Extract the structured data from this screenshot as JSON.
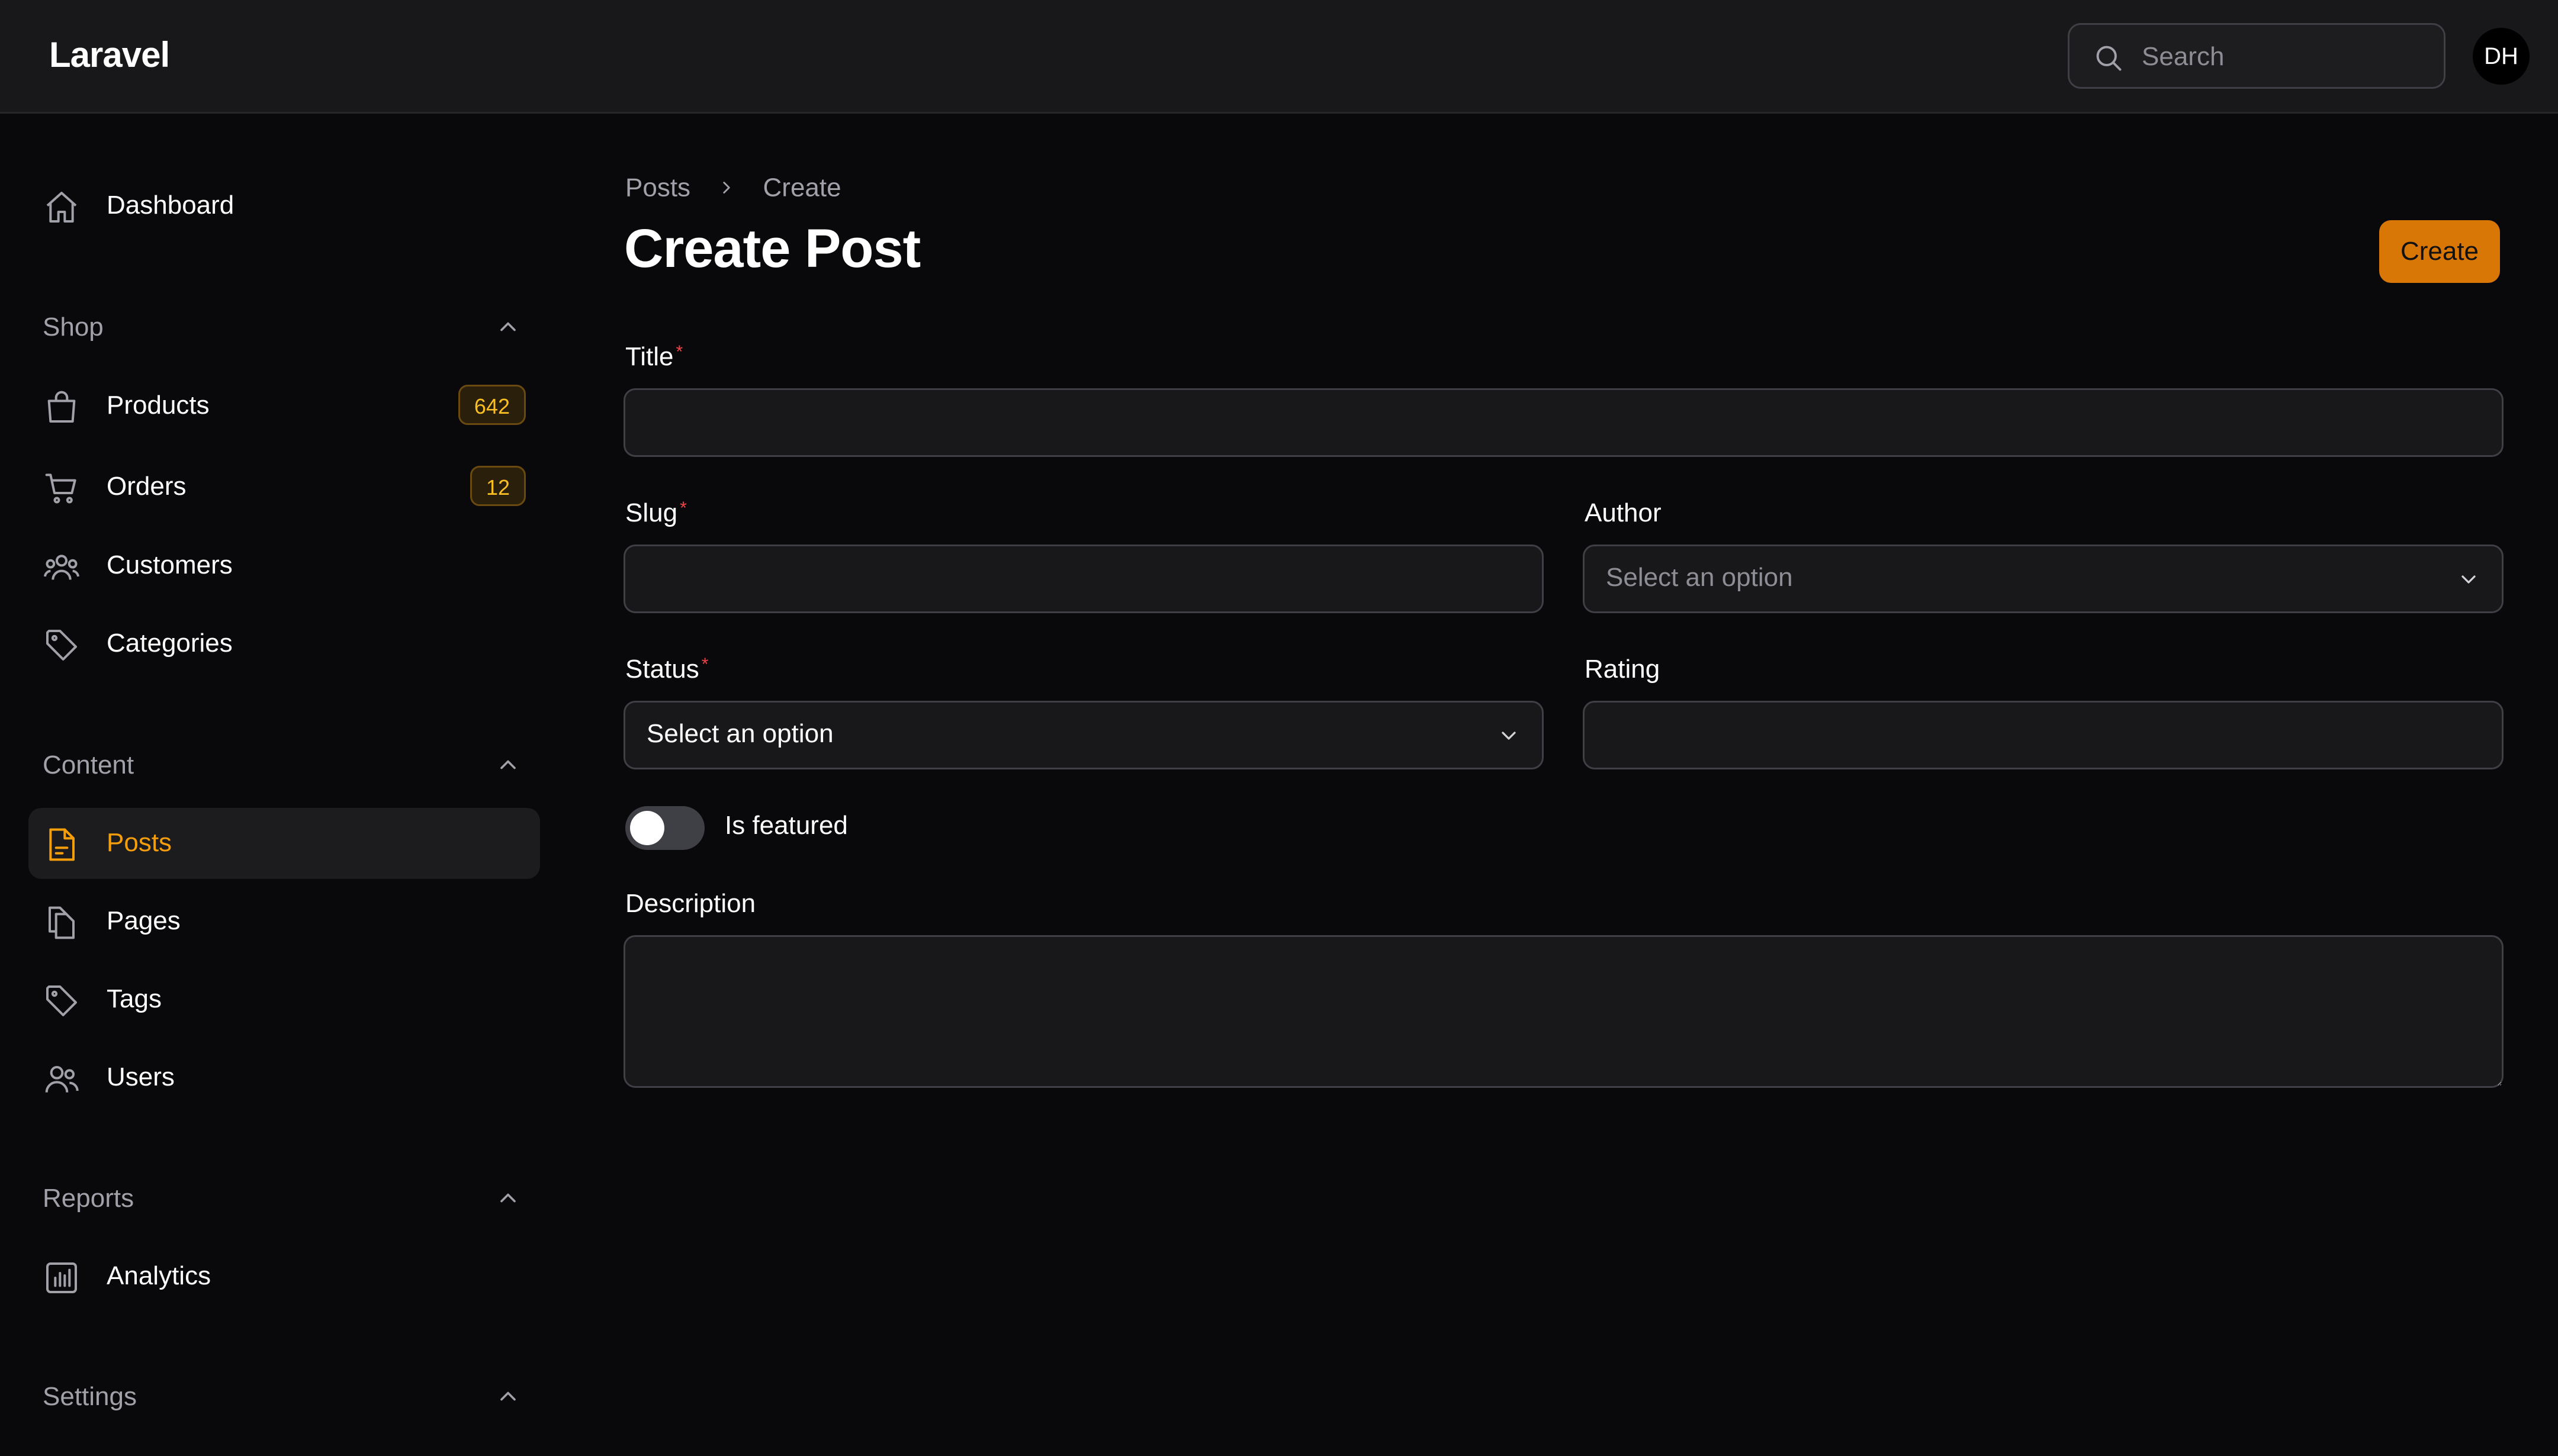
{
  "app": {
    "brand": "Laravel"
  },
  "header": {
    "search_placeholder": "Search",
    "avatar_initials": "DH"
  },
  "sidebar": {
    "dashboard": {
      "label": "Dashboard",
      "icon": "home-icon"
    },
    "groups": [
      {
        "label": "Shop",
        "expanded": true,
        "items": [
          {
            "label": "Products",
            "icon": "shopping-bag-icon",
            "badge": "642"
          },
          {
            "label": "Orders",
            "icon": "shopping-cart-icon",
            "badge": "12"
          },
          {
            "label": "Customers",
            "icon": "users-group-icon"
          },
          {
            "label": "Categories",
            "icon": "tag-icon"
          }
        ]
      },
      {
        "label": "Content",
        "expanded": true,
        "items": [
          {
            "label": "Posts",
            "icon": "document-text-icon",
            "active": true
          },
          {
            "label": "Pages",
            "icon": "documents-icon"
          },
          {
            "label": "Tags",
            "icon": "tag-icon"
          },
          {
            "label": "Users",
            "icon": "users-icon"
          }
        ]
      },
      {
        "label": "Reports",
        "expanded": true,
        "items": [
          {
            "label": "Analytics",
            "icon": "chart-bar-icon"
          }
        ]
      },
      {
        "label": "Settings",
        "expanded": true,
        "items": []
      }
    ]
  },
  "main": {
    "breadcrumb": [
      "Posts",
      "Create"
    ],
    "title": "Create Post",
    "create_button": "Create",
    "form": {
      "title": {
        "label": "Title",
        "required_marker": "*",
        "value": ""
      },
      "slug": {
        "label": "Slug",
        "required_marker": "*",
        "value": ""
      },
      "author": {
        "label": "Author",
        "value": "Select an option"
      },
      "status": {
        "label": "Status",
        "required_marker": "*",
        "value": "Select an option"
      },
      "rating": {
        "label": "Rating",
        "value": ""
      },
      "is_featured": {
        "label": "Is featured",
        "checked": false
      },
      "description": {
        "label": "Description",
        "value": ""
      }
    }
  },
  "colors": {
    "accent": "#f59e0b",
    "button": "#d97706",
    "background": "#09090b",
    "required": "#ef4444"
  }
}
